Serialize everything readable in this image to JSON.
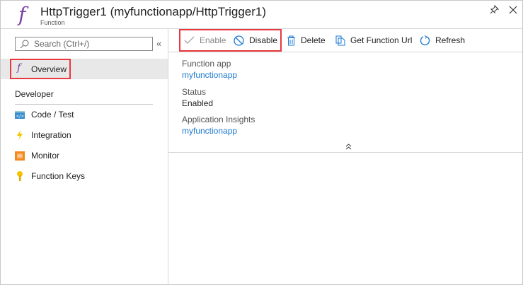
{
  "header": {
    "title": "HttpTrigger1 (myfunctionapp/HttpTrigger1)",
    "subtitle": "Function",
    "icon": "function-icon",
    "pin_icon": "pin-icon",
    "close_icon": "close-icon"
  },
  "sidebar": {
    "search_placeholder": "Search (Ctrl+/)",
    "collapse_glyph": "«",
    "overview": {
      "label": "Overview",
      "icon": "function-icon"
    },
    "section": "Developer",
    "items": [
      {
        "label": "Code / Test",
        "icon": "code-icon"
      },
      {
        "label": "Integration",
        "icon": "lightning-icon"
      },
      {
        "label": "Monitor",
        "icon": "monitor-icon"
      },
      {
        "label": "Function Keys",
        "icon": "key-icon"
      }
    ]
  },
  "toolbar": {
    "enable": "Enable",
    "disable": "Disable",
    "delete": "Delete",
    "get_url": "Get Function Url",
    "refresh": "Refresh"
  },
  "details": {
    "function_app_label": "Function app",
    "function_app_value": "myfunctionapp",
    "status_label": "Status",
    "status_value": "Enabled",
    "insights_label": "Application Insights",
    "insights_value": "myfunctionapp",
    "collapse_glyph": "⌃"
  },
  "colors": {
    "accent": "#1b78d0",
    "highlight": "#e8393f",
    "function": "#7a3fa0"
  }
}
